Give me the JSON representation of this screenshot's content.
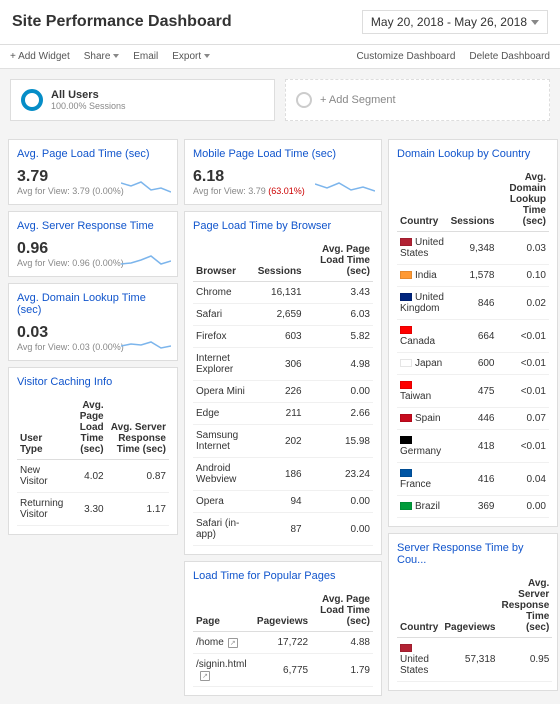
{
  "header": {
    "title": "Site Performance Dashboard",
    "date_range": "May 20, 2018 - May 26, 2018"
  },
  "toolbar": {
    "add_widget": "+ Add Widget",
    "share": "Share",
    "email": "Email",
    "export": "Export",
    "customize": "Customize Dashboard",
    "delete": "Delete Dashboard"
  },
  "segments": {
    "all_users": "All Users",
    "all_users_sub": "100.00% Sessions",
    "add_segment": "+ Add Segment"
  },
  "cards": {
    "avg_load": {
      "title": "Avg. Page Load Time (sec)",
      "value": "3.79",
      "sub": "Avg for View: 3.79 (0.00%)"
    },
    "mobile_load": {
      "title": "Mobile Page Load Time (sec)",
      "value": "6.18",
      "sub_pre": "Avg for View: 3.79 ",
      "sub_pct": "(63.01%)"
    },
    "server_resp": {
      "title": "Avg. Server Response Time",
      "value": "0.96",
      "sub": "Avg for View: 0.96 (0.00%)"
    },
    "domain_lookup": {
      "title": "Avg. Domain Lookup Time (sec)",
      "value": "0.03",
      "sub": "Avg for View: 0.03 (0.00%)"
    },
    "visitor_cache": {
      "title": "Visitor Caching Info",
      "h1": "User Type",
      "h2": "Avg. Page Load Time (sec)",
      "h3": "Avg. Server Response Time (sec)",
      "rows": [
        {
          "c1": "New Visitor",
          "c2": "4.02",
          "c3": "0.87"
        },
        {
          "c1": "Returning Visitor",
          "c2": "3.30",
          "c3": "1.17"
        }
      ]
    },
    "browser": {
      "title": "Page Load Time by Browser",
      "h1": "Browser",
      "h2": "Sessions",
      "h3": "Avg. Page Load Time (sec)",
      "rows": [
        {
          "c1": "Chrome",
          "c2": "16,131",
          "c3": "3.43"
        },
        {
          "c1": "Safari",
          "c2": "2,659",
          "c3": "6.03"
        },
        {
          "c1": "Firefox",
          "c2": "603",
          "c3": "5.82"
        },
        {
          "c1": "Internet Explorer",
          "c2": "306",
          "c3": "4.98"
        },
        {
          "c1": "Opera Mini",
          "c2": "226",
          "c3": "0.00"
        },
        {
          "c1": "Edge",
          "c2": "211",
          "c3": "2.66"
        },
        {
          "c1": "Samsung Internet",
          "c2": "202",
          "c3": "15.98"
        },
        {
          "c1": "Android Webview",
          "c2": "186",
          "c3": "23.24"
        },
        {
          "c1": "Opera",
          "c2": "94",
          "c3": "0.00"
        },
        {
          "c1": "Safari (in-app)",
          "c2": "87",
          "c3": "0.00"
        }
      ]
    },
    "popular": {
      "title": "Load Time for Popular Pages",
      "h1": "Page",
      "h2": "Pageviews",
      "h3": "Avg. Page Load Time (sec)",
      "rows": [
        {
          "c1": "/home",
          "c2": "17,722",
          "c3": "4.88"
        },
        {
          "c1": "/signin.html",
          "c2": "6,775",
          "c3": "1.79"
        }
      ]
    },
    "country_lookup": {
      "title": "Domain Lookup by Country",
      "h1": "Country",
      "h2": "Sessions",
      "h3": "Avg. Domain Lookup Time (sec)",
      "rows": [
        {
          "flag": "#b22234",
          "c1": "United States",
          "c2": "9,348",
          "c3": "0.03"
        },
        {
          "flag": "#ff9933",
          "c1": "India",
          "c2": "1,578",
          "c3": "0.10"
        },
        {
          "flag": "#00247d",
          "c1": "United Kingdom",
          "c2": "846",
          "c3": "0.02"
        },
        {
          "flag": "#ff0000",
          "c1": "Canada",
          "c2": "664",
          "c3": "<0.01"
        },
        {
          "flag": "#ffffff",
          "c1": "Japan",
          "c2": "600",
          "c3": "<0.01"
        },
        {
          "flag": "#fe0000",
          "c1": "Taiwan",
          "c2": "475",
          "c3": "<0.01"
        },
        {
          "flag": "#c60b1e",
          "c1": "Spain",
          "c2": "446",
          "c3": "0.07"
        },
        {
          "flag": "#000000",
          "c1": "Germany",
          "c2": "418",
          "c3": "<0.01"
        },
        {
          "flag": "#0055a4",
          "c1": "France",
          "c2": "416",
          "c3": "0.04"
        },
        {
          "flag": "#009c3b",
          "c1": "Brazil",
          "c2": "369",
          "c3": "0.00"
        }
      ]
    },
    "country_server": {
      "title": "Server Response Time by Cou...",
      "h1": "Country",
      "h2": "Pageviews",
      "h3": "Avg. Server Response Time (sec)",
      "rows": [
        {
          "flag": "#b22234",
          "c1": "United States",
          "c2": "57,318",
          "c3": "0.95"
        }
      ]
    }
  }
}
